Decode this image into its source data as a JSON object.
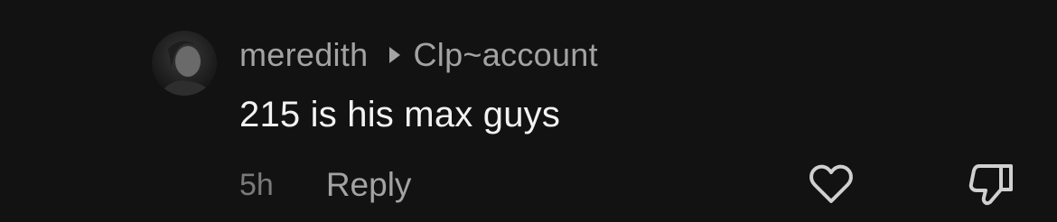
{
  "comment": {
    "author": "meredith",
    "reply_to": "Clp~account",
    "text": "215 is his max guys",
    "age": "5h",
    "reply_label": "Reply",
    "avatar_icon": "user-avatar",
    "like_icon": "heart-outline-icon",
    "dislike_icon": "thumbs-down-icon"
  },
  "colors": {
    "background": "#121212",
    "meta_text": "#a3a3a3",
    "body_text": "#f2f2f2",
    "time_text": "#7a7a7a",
    "icon": "#d0d0d0"
  }
}
